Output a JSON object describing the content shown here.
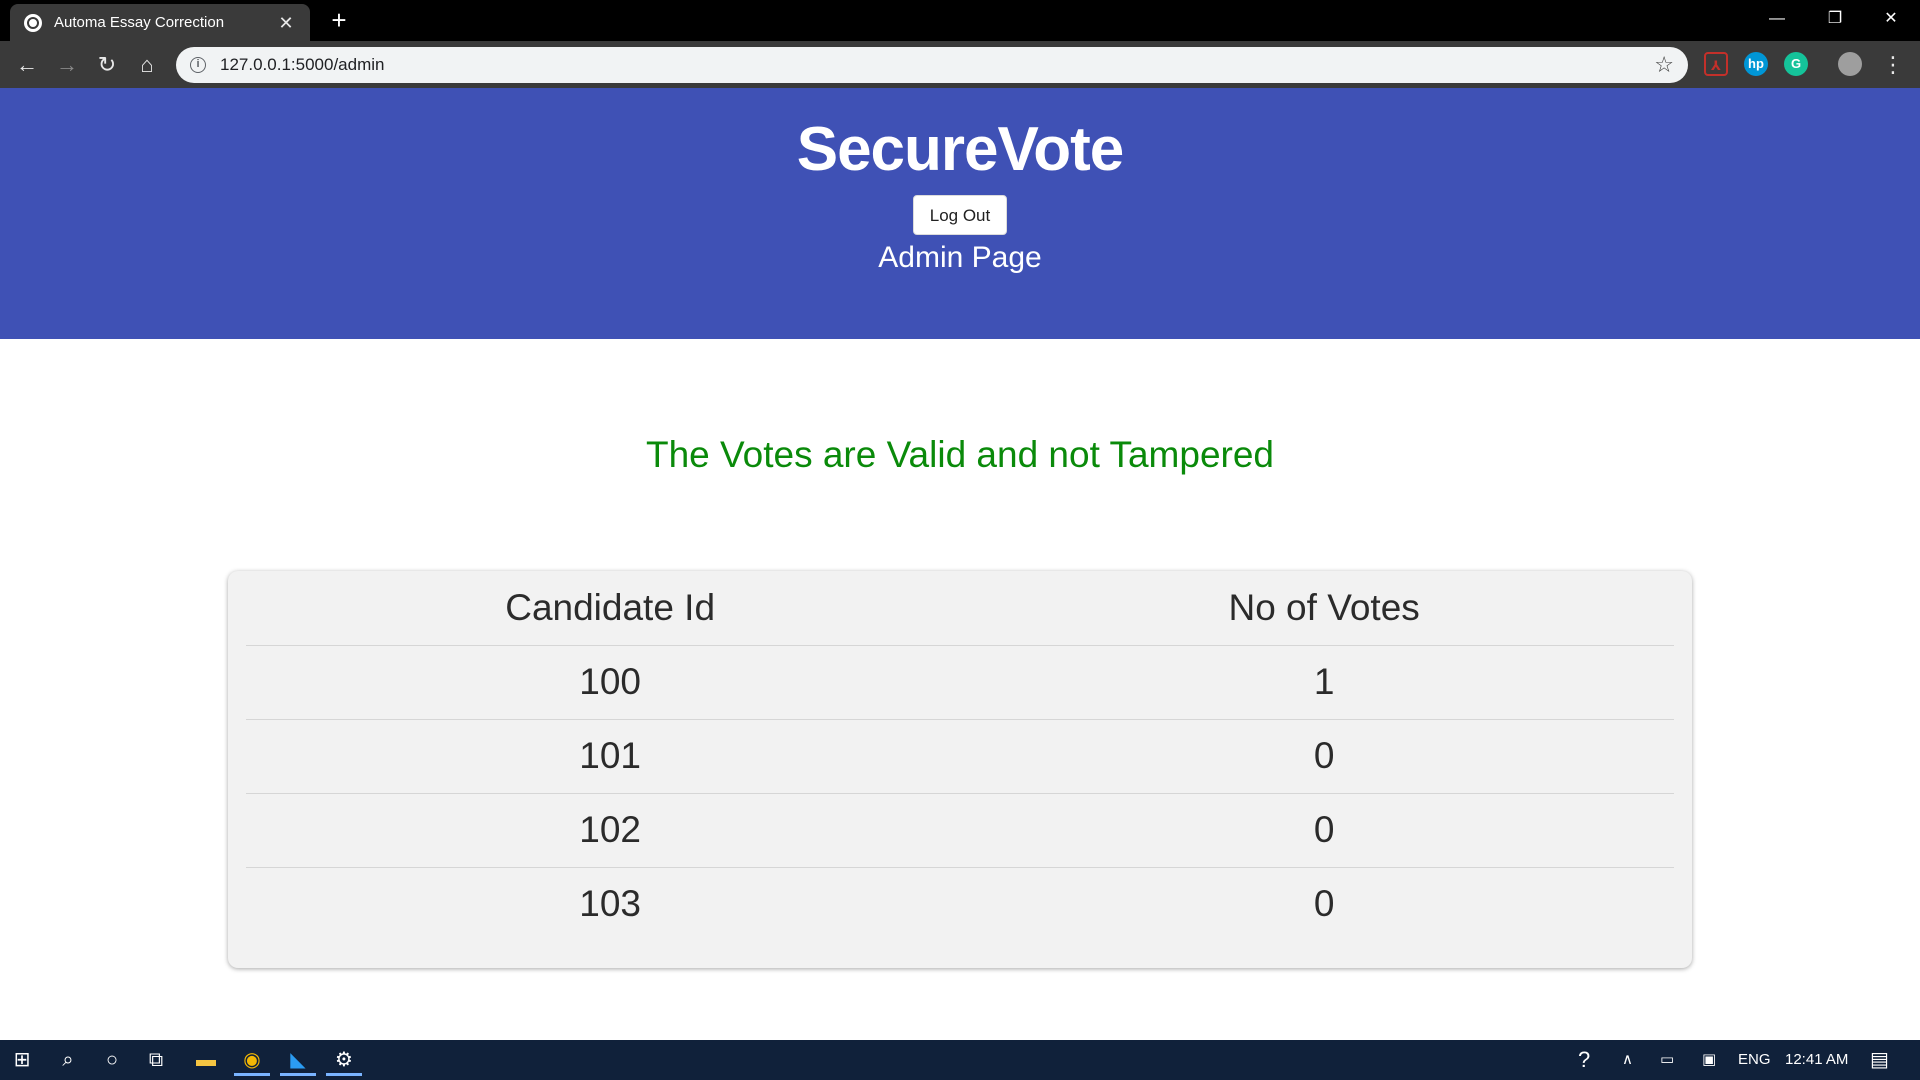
{
  "browser": {
    "tab_title": "Automa Essay Correction",
    "tab_close": "✕",
    "new_tab": "+",
    "url": "127.0.0.1:5000/admin",
    "window_controls": {
      "minimize": "—",
      "restore": "❐",
      "close": "✕"
    }
  },
  "header": {
    "brand": "SecureVote",
    "logout_label": "Log Out",
    "page_title": "Admin Page"
  },
  "status_message": "The Votes are Valid and not Tampered",
  "results_table": {
    "columns": [
      "Candidate Id",
      "No of Votes"
    ],
    "rows": [
      [
        "100",
        "1"
      ],
      [
        "101",
        "0"
      ],
      [
        "102",
        "0"
      ],
      [
        "103",
        "0"
      ]
    ]
  },
  "taskbar": {
    "language": "ENG",
    "time": "12:41 AM"
  },
  "colors": {
    "header_bg": "#3f51b5",
    "status_green": "#0a8a0a",
    "taskbar_bg": "#10213a"
  }
}
